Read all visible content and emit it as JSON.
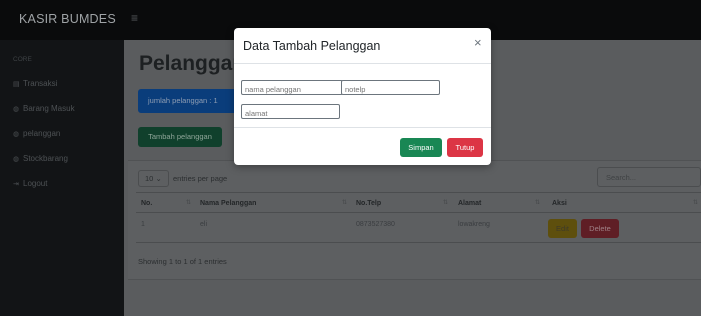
{
  "app": {
    "brand": "KASIR BUMDES",
    "menu_icon": "≡"
  },
  "sidebar": {
    "heading": "core",
    "items": [
      {
        "label": "Transaksi",
        "icon": "▤"
      },
      {
        "label": "Barang Masuk",
        "icon": "◍"
      },
      {
        "label": "pelanggan",
        "icon": "◍"
      },
      {
        "label": "Stockbarang",
        "icon": "◍"
      },
      {
        "label": "Logout",
        "icon": "⇥"
      }
    ]
  },
  "main": {
    "title": "Pelanggan",
    "count_label": "jumlah pelanggan : 1",
    "add_button": "Tambah pelanggan"
  },
  "table": {
    "length_value": "10",
    "length_suffix": "entries per page",
    "search_placeholder": "Search...",
    "columns": [
      "No.",
      "Nama Pelanggan",
      "No.Telp",
      "Alamat",
      "Aksi"
    ],
    "rows": [
      {
        "no": "1",
        "nama": "eli",
        "telp": "0873527380",
        "alamat": "lowakreng"
      }
    ],
    "edit_label": "Edit",
    "delete_label": "Delete",
    "footer": "Showing 1 to 1 of 1 entries"
  },
  "modal": {
    "title": "Data Tambah Pelanggan",
    "close_icon": "×",
    "fields": {
      "nama_placeholder": "nama pelanggan",
      "telp_placeholder": "notelp",
      "alamat_placeholder": "alamat"
    },
    "save_label": "Simpan",
    "close_label": "Tutup"
  },
  "colors": {
    "save": "#198754",
    "close": "#dc3545",
    "count_box": "#0d6efd",
    "add_button": "#198754",
    "edit": "#ffc107",
    "delete": "#dc3545"
  }
}
